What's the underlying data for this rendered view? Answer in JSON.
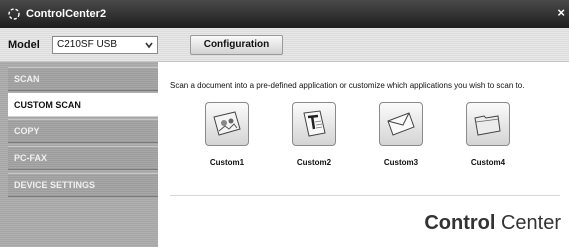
{
  "window": {
    "title": "ControlCenter2",
    "close_glyph": "×"
  },
  "toolbar": {
    "model_label": "Model",
    "model_value": "C210SF USB",
    "configuration_label": "Configuration"
  },
  "sidebar": {
    "items": [
      {
        "label": "SCAN",
        "active": false
      },
      {
        "label": "CUSTOM SCAN",
        "active": true
      },
      {
        "label": "COPY",
        "active": false
      },
      {
        "label": "PC-FAX",
        "active": false
      },
      {
        "label": "DEVICE SETTINGS",
        "active": false
      }
    ]
  },
  "main": {
    "description": "Scan a document into a pre-defined application or customize which applications you wish to scan to.",
    "buttons": [
      {
        "label": "Custom1",
        "icon": "image-icon"
      },
      {
        "label": "Custom2",
        "icon": "text-document-icon"
      },
      {
        "label": "Custom3",
        "icon": "envelope-icon"
      },
      {
        "label": "Custom4",
        "icon": "folder-icon"
      }
    ]
  },
  "brand": {
    "bold": "Control",
    "regular": " Center"
  },
  "colors": {
    "titlebar": "#2a2a2a",
    "sidebar": "#a8a8a8",
    "active": "#ffffff"
  }
}
